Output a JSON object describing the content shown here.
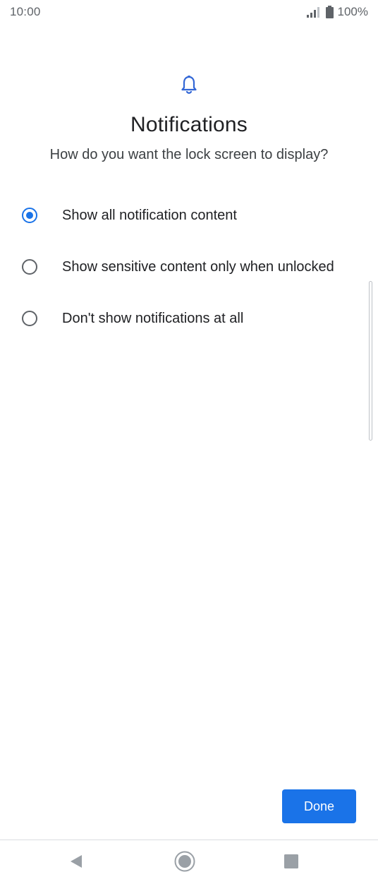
{
  "status_bar": {
    "time": "10:00",
    "battery_text": "100%",
    "icons": [
      "signal-icon",
      "battery-icon"
    ]
  },
  "header": {
    "icon": "bell-icon",
    "title": "Notifications",
    "subtitle": "How do you want the lock screen to display?"
  },
  "options": [
    {
      "label": "Show all notification content",
      "selected": true
    },
    {
      "label": "Show sensitive content only when unlocked",
      "selected": false
    },
    {
      "label": "Don't show notifications at all",
      "selected": false
    }
  ],
  "actions": {
    "done_label": "Done"
  },
  "nav": {
    "icons": [
      "back-icon",
      "home-icon",
      "recents-icon"
    ]
  },
  "colors": {
    "accent": "#1a73e8",
    "text": "#202124",
    "secondary": "#5f6368"
  }
}
